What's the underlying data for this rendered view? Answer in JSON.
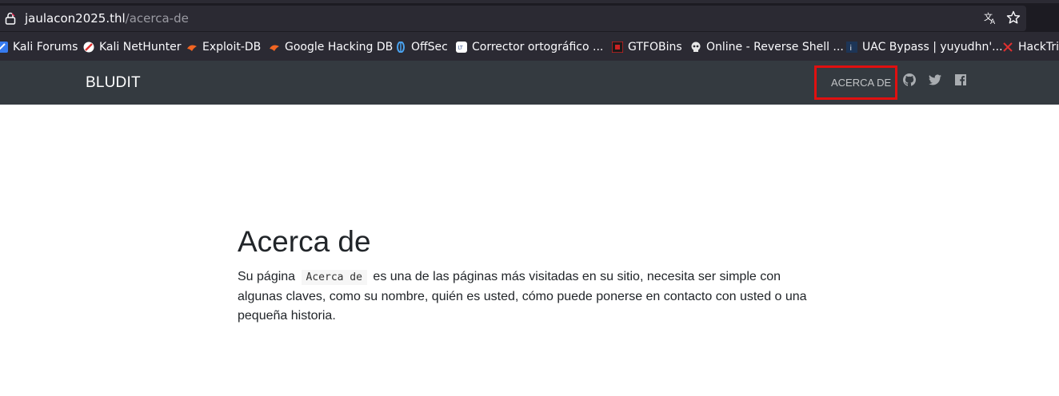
{
  "browser": {
    "url_host": "jaulacon2025.thl",
    "url_path": "/acerca-de",
    "bookmarks": [
      {
        "label": "Kali Forums",
        "icon": "kali-forums-icon"
      },
      {
        "label": "Kali NetHunter",
        "icon": "kali-nethunter-icon"
      },
      {
        "label": "Exploit-DB",
        "icon": "exploit-db-icon"
      },
      {
        "label": "Google Hacking DB",
        "icon": "google-hacking-db-icon"
      },
      {
        "label": "OffSec",
        "icon": "offsec-icon"
      },
      {
        "label": "Corrector ortográfico ...",
        "icon": "corrector-icon"
      },
      {
        "label": "GTFOBins",
        "icon": "gtfobins-icon"
      },
      {
        "label": "Online - Reverse Shell ...",
        "icon": "skull-icon"
      },
      {
        "label": "UAC Bypass | yuyudhn'...",
        "icon": "uac-bypass-icon"
      },
      {
        "label": "HackTric",
        "icon": "hacktricks-icon"
      }
    ]
  },
  "navbar": {
    "brand": "BLUDIT",
    "links": [
      {
        "label": "ACERCA DE"
      }
    ],
    "social_icons": [
      "github-icon",
      "twitter-icon",
      "facebook-icon"
    ]
  },
  "page": {
    "title": "Acerca de",
    "body_before": "Su página",
    "body_code": "Acerca de",
    "body_after": "es una de las páginas más visitadas en su sitio, necesita ser simple con algunas claves, como su nombre, quién es usted, cómo puede ponerse en contacto con usted o una pequeña historia."
  },
  "colors": {
    "navbar_bg": "#343a40",
    "highlight": "#e01010",
    "chrome_bg": "#2b2a33"
  }
}
